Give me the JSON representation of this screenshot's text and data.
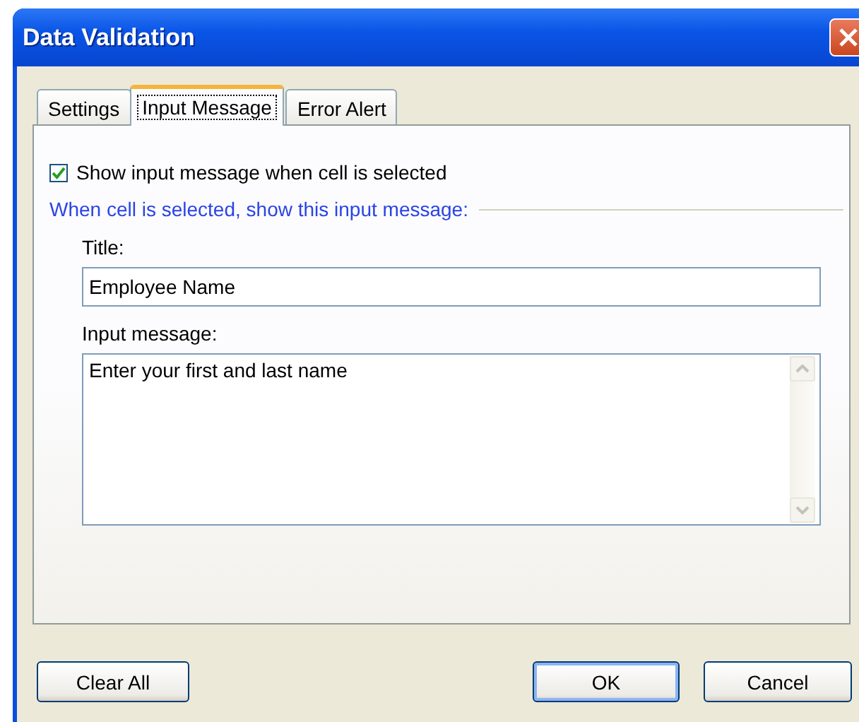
{
  "window": {
    "title": "Data Validation"
  },
  "tabs": [
    {
      "label": "Settings",
      "selected": false
    },
    {
      "label": "Input Message",
      "selected": true
    },
    {
      "label": "Error Alert",
      "selected": false
    }
  ],
  "show_checkbox": {
    "label": "Show input message when cell is selected",
    "checked": true
  },
  "group_label": "When cell is selected, show this input message:",
  "title_field": {
    "label": "Title:",
    "value": "Employee Name"
  },
  "message_field": {
    "label": "Input message:",
    "value": "Enter your first and last name"
  },
  "buttons": [
    {
      "label": "Clear All",
      "default": false
    },
    {
      "label": "OK",
      "default": true
    },
    {
      "label": "Cancel",
      "default": false
    }
  ]
}
